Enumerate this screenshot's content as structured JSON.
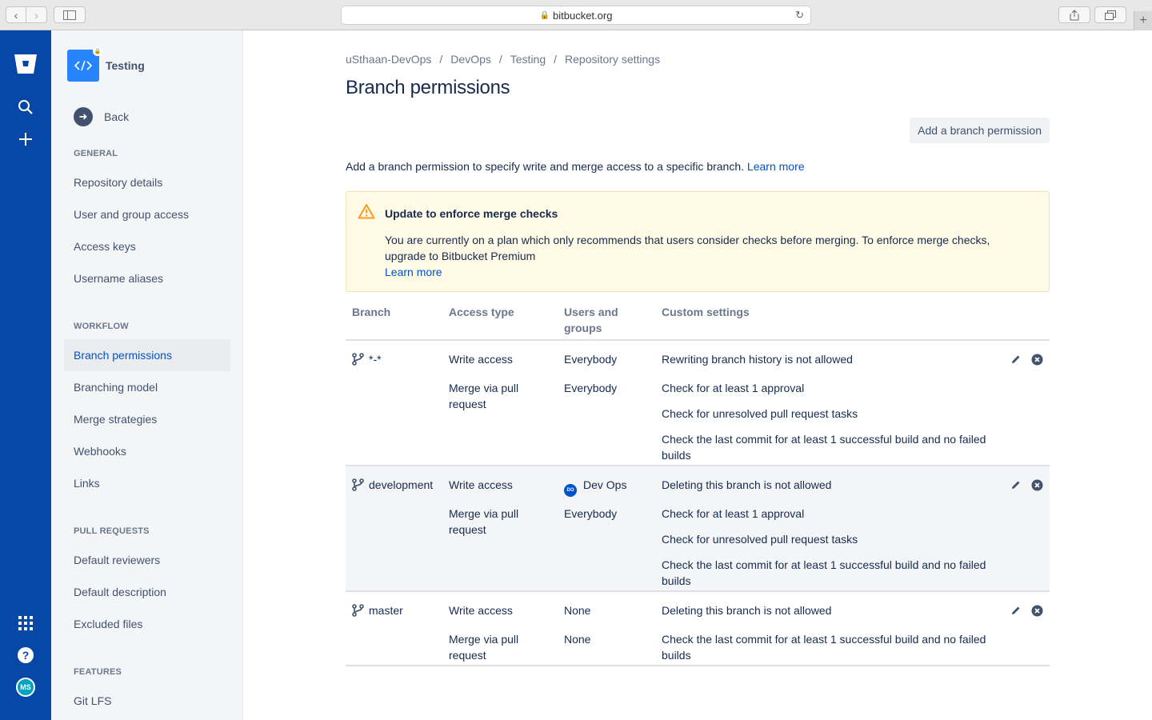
{
  "browser": {
    "url": "bitbucket.org"
  },
  "sidebar": {
    "repo_name": "Testing",
    "back_label": "Back",
    "sections": [
      {
        "title": "GENERAL",
        "items": [
          "Repository details",
          "User and group access",
          "Access keys",
          "Username aliases"
        ]
      },
      {
        "title": "WORKFLOW",
        "items": [
          "Branch permissions",
          "Branching model",
          "Merge strategies",
          "Webhooks",
          "Links"
        ]
      },
      {
        "title": "PULL REQUESTS",
        "items": [
          "Default reviewers",
          "Default description",
          "Excluded files"
        ]
      },
      {
        "title": "FEATURES",
        "items": [
          "Git LFS"
        ]
      }
    ],
    "active_item": "Branch permissions"
  },
  "breadcrumb": [
    "uSthaan-DevOps",
    "DevOps",
    "Testing",
    "Repository settings"
  ],
  "page_title": "Branch permissions",
  "add_button": "Add a branch permission",
  "intro": {
    "text": "Add a branch permission to specify write and merge access to a specific branch.",
    "link": "Learn more"
  },
  "warning": {
    "title": "Update to enforce merge checks",
    "body": "You are currently on a plan which only recommends that users consider checks before merging. To enforce merge checks, upgrade to Bitbucket Premium",
    "link": "Learn more"
  },
  "table": {
    "headers": {
      "branch": "Branch",
      "access": "Access type",
      "users": "Users and groups",
      "custom": "Custom settings"
    },
    "rows": [
      {
        "branch": "*-*",
        "write_access": "Write access",
        "write_users": "Everybody",
        "merge_access": "Merge via pull request",
        "merge_users": "Everybody",
        "settings": [
          "Rewriting branch history is not allowed",
          "Check for at least 1 approval",
          "Check for unresolved pull request tasks",
          "Check the last commit for at least 1 successful build and no failed builds"
        ]
      },
      {
        "branch": "development",
        "write_access": "Write access",
        "write_users": "Dev Ops",
        "write_users_avatar": "DO",
        "merge_access": "Merge via pull request",
        "merge_users": "Everybody",
        "settings": [
          "Deleting this branch is not allowed",
          "Check for at least 1 approval",
          "Check for unresolved pull request tasks",
          "Check the last commit for at least 1 successful build and no failed builds"
        ]
      },
      {
        "branch": "master",
        "write_access": "Write access",
        "write_users": "None",
        "merge_access": "Merge via pull request",
        "merge_users": "None",
        "settings": [
          "Deleting this branch is not allowed",
          "Check the last commit for at least 1 successful build and no failed builds"
        ]
      }
    ]
  },
  "user_avatar": "MS",
  "colors": {
    "nav": "#0747a6",
    "link": "#0052cc",
    "warning_bg": "#fffae6"
  }
}
